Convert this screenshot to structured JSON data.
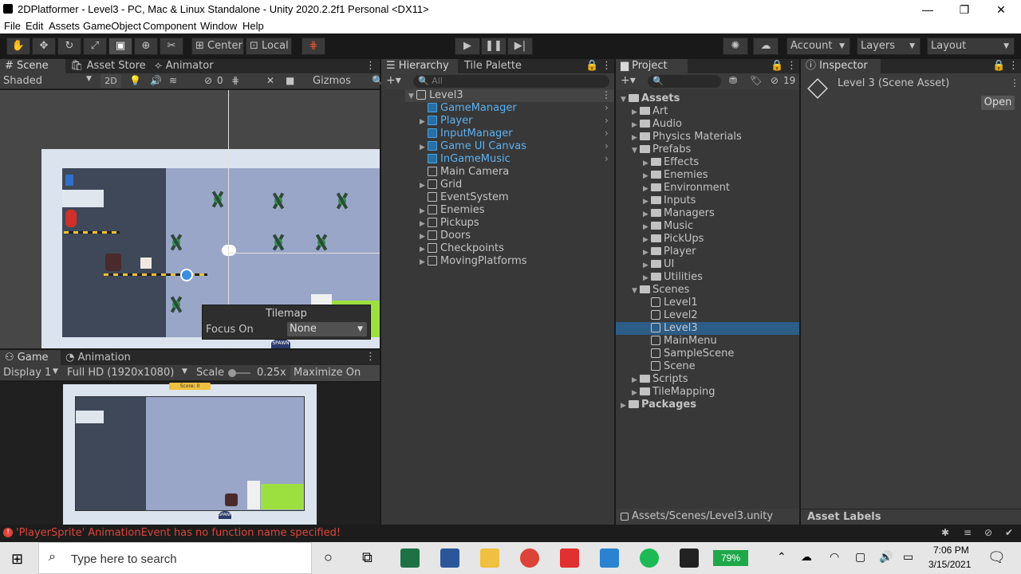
{
  "window": {
    "title": "2DPlatformer - Level3 - PC, Mac & Linux Standalone - Unity 2020.2.2f1 Personal <DX11>",
    "minimize": "—",
    "maximize": "❐",
    "close": "✕"
  },
  "menu": [
    "File",
    "Edit",
    "Assets",
    "GameObject",
    "Component",
    "Window",
    "Help"
  ],
  "toolbar": {
    "pivot_label": "Center",
    "space_label": "Local",
    "account_label": "Account",
    "layers_label": "Layers",
    "layout_label": "Layout"
  },
  "scene_panel": {
    "tabs": [
      "Scene",
      "Asset Store",
      "Animator"
    ],
    "shading": "Shaded",
    "mode_2d": "2D",
    "hidden_count": "0",
    "gizmos": "Gizmos",
    "overlay": {
      "title": "Tilemap",
      "focus_label": "Focus On",
      "focus_value": "None"
    },
    "spawn_label": "SPAWN"
  },
  "game_panel": {
    "tabs": [
      "Game",
      "Animation"
    ],
    "display": "Display 1",
    "resolution": "Full HD (1920x1080)",
    "scale_label": "Scale",
    "scale_value": "0.25x",
    "maximize": "Maximize On Play",
    "score": "Score: 0",
    "spawn_label": "SPAWN"
  },
  "hierarchy": {
    "tabs": [
      "Hierarchy",
      "Tile Palette"
    ],
    "search_placeholder": "All",
    "scene": "Level3",
    "items": [
      {
        "label": "GameManager",
        "prefab": true,
        "expandable": false
      },
      {
        "label": "Player",
        "prefab": true,
        "expandable": true
      },
      {
        "label": "InputManager",
        "prefab": true,
        "expandable": false
      },
      {
        "label": "Game UI Canvas",
        "prefab": true,
        "expandable": true
      },
      {
        "label": "InGameMusic",
        "prefab": true,
        "expandable": false
      },
      {
        "label": "Main Camera",
        "prefab": false,
        "expandable": false
      },
      {
        "label": "Grid",
        "prefab": false,
        "expandable": true
      },
      {
        "label": "EventSystem",
        "prefab": false,
        "expandable": false
      },
      {
        "label": "Enemies",
        "prefab": false,
        "expandable": true
      },
      {
        "label": "Pickups",
        "prefab": false,
        "expandable": true
      },
      {
        "label": "Doors",
        "prefab": false,
        "expandable": true
      },
      {
        "label": "Checkpoints",
        "prefab": false,
        "expandable": true
      },
      {
        "label": "MovingPlatforms",
        "prefab": false,
        "expandable": true
      }
    ]
  },
  "project": {
    "tab": "Project",
    "hidden_count": "19",
    "root": "Assets",
    "folders": [
      "Art",
      "Audio",
      "Physics Materials"
    ],
    "prefabs_label": "Prefabs",
    "prefab_folders": [
      "Effects",
      "Enemies",
      "Environment",
      "Inputs",
      "Managers",
      "Music",
      "PickUps",
      "Player",
      "UI",
      "Utilities"
    ],
    "scenes_label": "Scenes",
    "scenes": [
      "Level1",
      "Level2",
      "Level3",
      "MainMenu",
      "SampleScene",
      "Scene"
    ],
    "selected_scene": "Level3",
    "after_folders": [
      "Scripts",
      "TileMapping"
    ],
    "packages": "Packages",
    "path": "Assets/Scenes/Level3.unity"
  },
  "inspector": {
    "tab": "Inspector",
    "asset_title": "Level 3 (Scene Asset)",
    "open_button": "Open",
    "asset_labels": "Asset Labels"
  },
  "status": {
    "message": "'PlayerSprite' AnimationEvent has no function name specified!"
  },
  "taskbar": {
    "search_placeholder": "Type here to search",
    "battery": "79%",
    "time": "7:06 PM",
    "date": "3/15/2021"
  }
}
